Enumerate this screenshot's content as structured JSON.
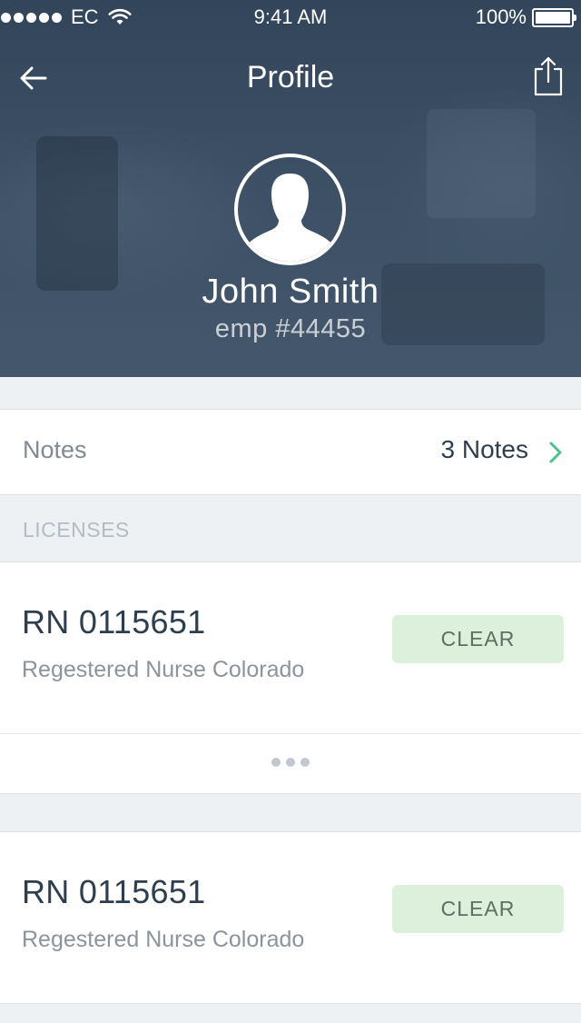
{
  "status_bar": {
    "carrier": "EC",
    "time": "9:41 AM",
    "battery": "100%"
  },
  "nav": {
    "title": "Profile",
    "back_icon": "arrow-left-icon",
    "share_icon": "share-icon"
  },
  "profile": {
    "name": "John Smith",
    "employee_id": "emp #44455",
    "avatar_icon": "person-silhouette-icon"
  },
  "notes": {
    "label": "Notes",
    "count": "3 Notes",
    "accent_color": "#4cc38a"
  },
  "licenses": {
    "section_title": "LICENSES",
    "items": [
      {
        "number": "RN 0115651",
        "description": "Regestered Nurse Colorado",
        "status": "CLEAR"
      },
      {
        "number": "RN 0115651",
        "description": "Regestered Nurse Colorado",
        "status": "CLEAR"
      }
    ]
  },
  "colors": {
    "header_bg": "#3c4f64",
    "clear_badge_bg": "#dcf0dc",
    "text_dark": "#2f3e4f"
  }
}
